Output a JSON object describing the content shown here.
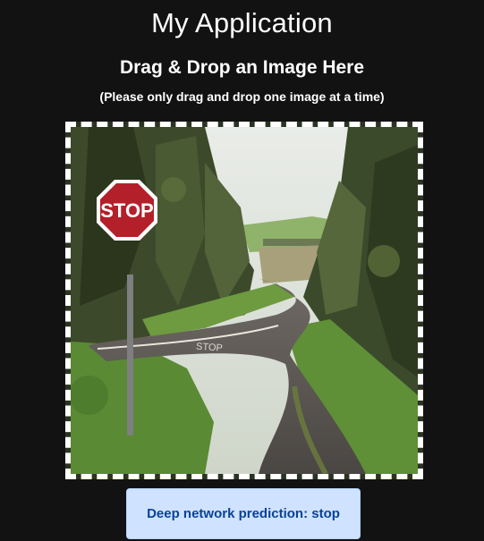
{
  "app": {
    "title": "My Application"
  },
  "upload": {
    "heading": "Drag & Drop an Image Here",
    "note": "(Please only drag and drop one image at a time)",
    "image": {
      "subject": "stop sign beside a winding country road",
      "sign_text": "STOP",
      "road_text": "STOP"
    }
  },
  "result": {
    "prediction_text": "Deep network prediction: stop"
  },
  "colors": {
    "background": "#121212",
    "alert_bg": "#cfe2ff",
    "alert_text": "#084298",
    "stop_red": "#b3202a"
  }
}
